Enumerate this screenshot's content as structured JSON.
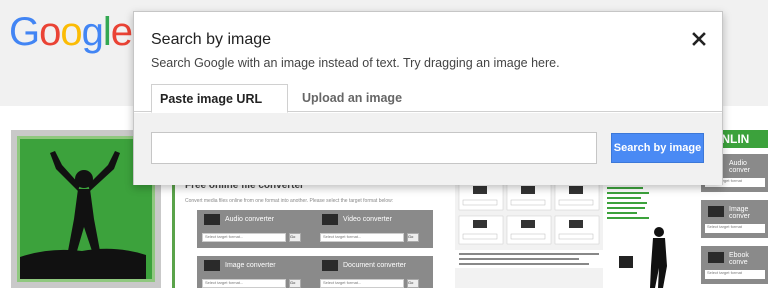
{
  "logo": {
    "letters": [
      "G",
      "o",
      "o",
      "g",
      "l",
      "e"
    ],
    "colors": [
      "#4285f4",
      "#ea4335",
      "#fbbc05",
      "#4285f4",
      "#34a853",
      "#ea4335"
    ]
  },
  "dialog": {
    "title": "Search by image",
    "description": "Search Google with an image instead of text. Try dragging an image here.",
    "close_icon": "close-icon",
    "tabs": [
      {
        "label": "Paste image URL",
        "active": true,
        "help_glyph": "?"
      },
      {
        "label": "Upload an image",
        "active": false
      }
    ],
    "url_input": {
      "value": "",
      "placeholder": ""
    },
    "search_button_label": "Search by image"
  },
  "results": {
    "converter_thumb": {
      "heading": "Free online file converter",
      "subtext": "Convert media files online from one format into another. Please select the target format below:",
      "cards": [
        {
          "label": "Audio converter",
          "select": "Select target format...",
          "go": "Go"
        },
        {
          "label": "Video converter",
          "select": "Select target format...",
          "go": "Go"
        },
        {
          "label": "Image converter",
          "select": "Select target format...",
          "go": "Go"
        },
        {
          "label": "Document converter",
          "select": "Select target format...",
          "go": "Go"
        }
      ]
    },
    "right_thumb": {
      "banner": "ONLIN",
      "cards": [
        {
          "label": "Audio conver",
          "select": "Select target format"
        },
        {
          "label": "Image conver",
          "select": "Select target format"
        },
        {
          "label": "Ebook conve",
          "select": "Select target format"
        }
      ]
    }
  },
  "colors": {
    "accent_blue": "#4a8af4",
    "header_gray": "#f1f1f1",
    "green": "#3ca23c"
  }
}
